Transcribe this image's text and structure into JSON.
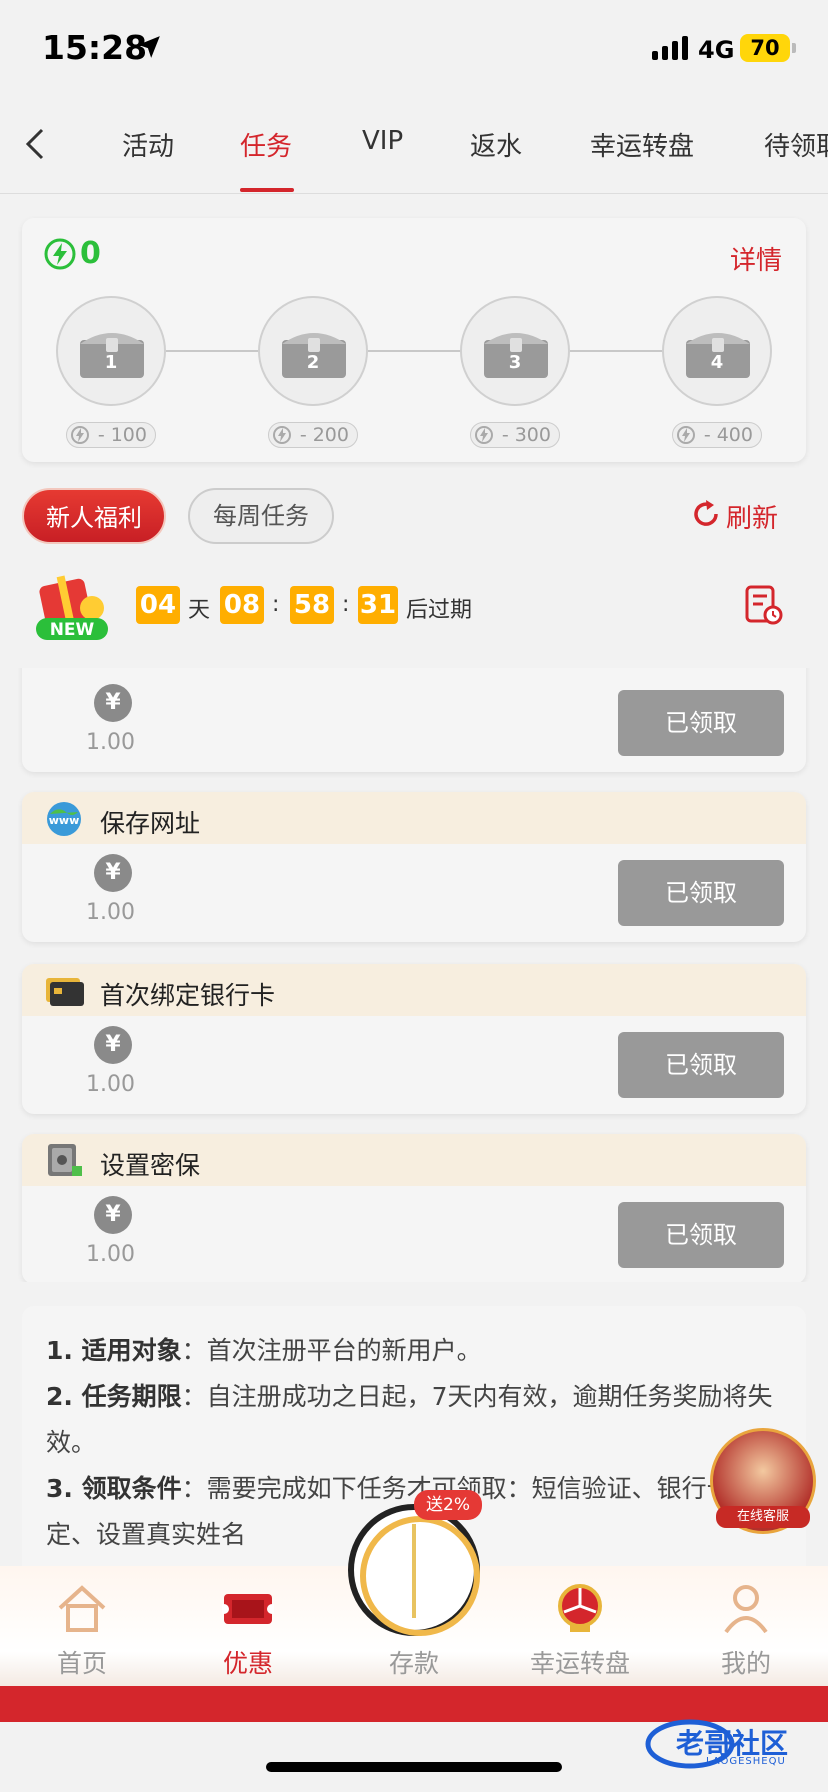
{
  "status": {
    "time": "15:28",
    "network": "4G",
    "battery": "70"
  },
  "tabs": [
    {
      "label": "活动"
    },
    {
      "label": "任务",
      "active": true
    },
    {
      "label": "VIP"
    },
    {
      "label": "返水"
    },
    {
      "label": "幸运转盘"
    },
    {
      "label": "待领取"
    }
  ],
  "energy": {
    "count": "0",
    "detail_label": "详情",
    "chests": [
      {
        "num": "1",
        "cost": "- 100"
      },
      {
        "num": "2",
        "cost": "- 200"
      },
      {
        "num": "3",
        "cost": "- 300"
      },
      {
        "num": "4",
        "cost": "- 400"
      }
    ]
  },
  "segments": {
    "newbie": "新人福利",
    "weekly": "每周任务",
    "refresh": "刷新"
  },
  "countdown": {
    "days": "04",
    "days_unit": "天",
    "hours": "08",
    "sep": ":",
    "minutes": "58",
    "seconds": "31",
    "suffix": "后过期",
    "badge": "NEW"
  },
  "tasks": [
    {
      "name": "",
      "amount": "1.00",
      "button": "已领取",
      "yen": "¥"
    },
    {
      "name": "保存网址",
      "amount": "1.00",
      "button": "已领取",
      "yen": "¥"
    },
    {
      "name": "首次绑定银行卡",
      "amount": "1.00",
      "button": "已领取",
      "yen": "¥"
    },
    {
      "name": "设置密保",
      "amount": "1.00",
      "button": "已领取",
      "yen": "¥"
    }
  ],
  "rules": [
    {
      "label": "1. 适用对象",
      "text": "首次注册平台的新用户。"
    },
    {
      "label": "2. 任务期限",
      "text": "自注册成功之日起，7天内有效，逾期任务奖励将失效。"
    },
    {
      "label": "3. 领取条件",
      "text": "需要完成如下任务才可领取：短信验证、银行卡绑定、设置真实姓名"
    }
  ],
  "support": {
    "label": "在线客服"
  },
  "nav": {
    "home": "首页",
    "promo": "优惠",
    "deposit": "存款",
    "deposit_badge": "送2%",
    "wheel": "幸运转盘",
    "mine": "我的"
  },
  "watermark": {
    "title": "老哥社区",
    "sub": "LAOGESHEQU"
  },
  "colors": {
    "accent": "#d4262c",
    "energy": "#2bbf3a",
    "timer": "#ffae00",
    "claimed": "#999999"
  }
}
